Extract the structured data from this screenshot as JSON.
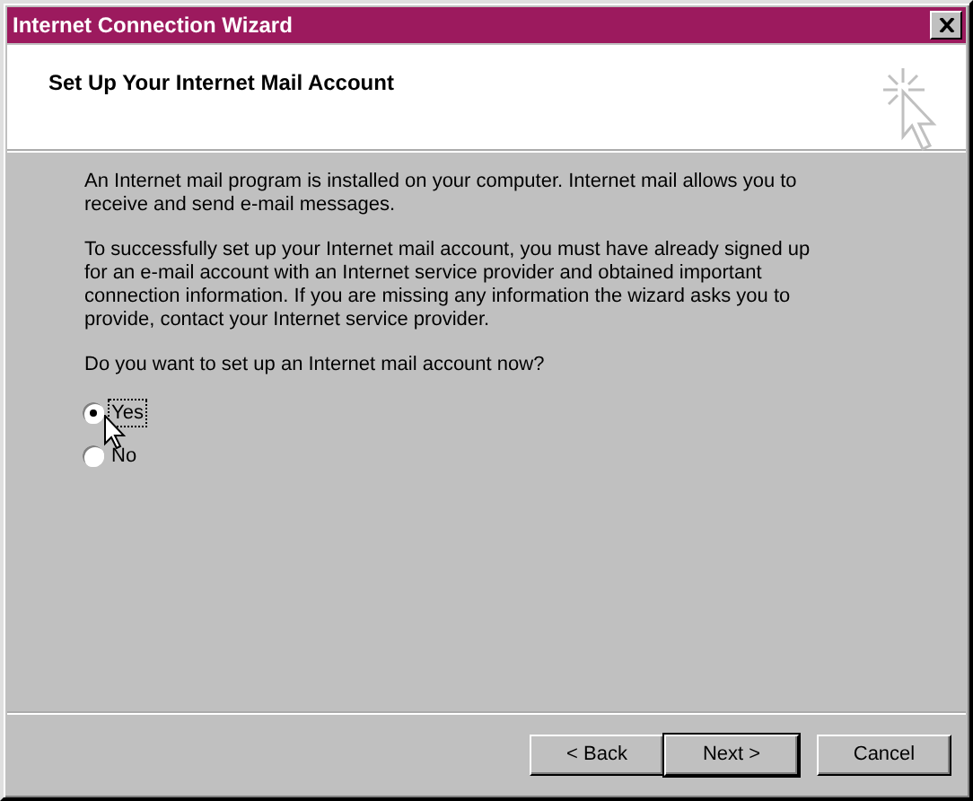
{
  "window": {
    "title": "Internet Connection Wizard"
  },
  "header": {
    "title": "Set Up Your Internet Mail Account"
  },
  "paragraphs": [
    "An Internet mail program is installed on your computer. Internet mail allows you to receive and send e-mail messages.",
    "To successfully set up your Internet mail account, you must have already signed up for an e-mail account with an Internet service provider and obtained important connection information. If you are missing any information the wizard asks you to provide, contact your Internet service provider."
  ],
  "question": "Do you want to set up an Internet mail account now?",
  "options": [
    {
      "label": "Yes",
      "selected": true,
      "focused": true
    },
    {
      "label": "No",
      "selected": false,
      "focused": false
    }
  ],
  "buttons": [
    {
      "label": "< Back",
      "default": false
    },
    {
      "label": "Next >",
      "default": true
    },
    {
      "label": "Cancel",
      "default": false
    }
  ]
}
